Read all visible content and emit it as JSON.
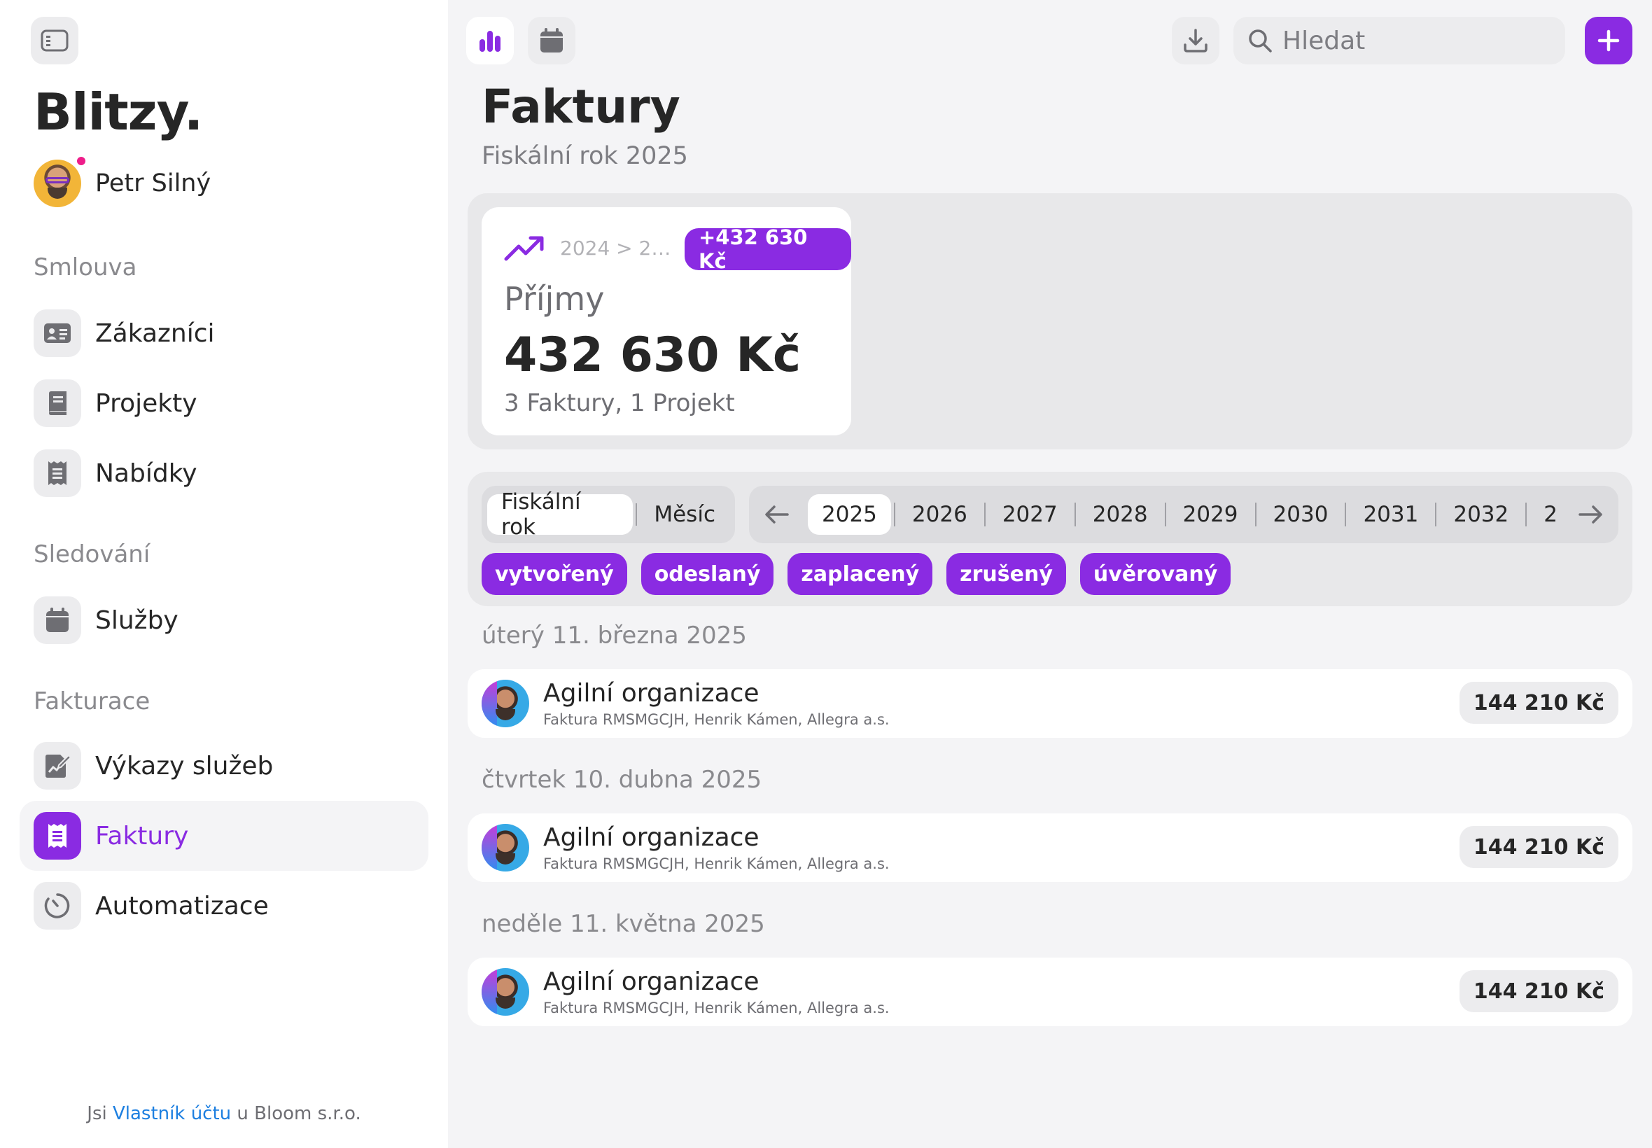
{
  "sidebar": {
    "brand": "Blitzy.",
    "user_name": "Petr Silný",
    "sections": [
      {
        "title": "Smlouva",
        "items": [
          {
            "label": "Zákazníci"
          },
          {
            "label": "Projekty"
          },
          {
            "label": "Nabídky"
          }
        ]
      },
      {
        "title": "Sledování",
        "items": [
          {
            "label": "Služby"
          }
        ]
      },
      {
        "title": "Fakturace",
        "items": [
          {
            "label": "Výkazy služeb"
          },
          {
            "label": "Faktury",
            "active": true
          },
          {
            "label": "Automatizace"
          }
        ]
      }
    ],
    "footer": {
      "prefix": "Jsi",
      "role": "Vlastník účtu",
      "suffix": "u Bloom s.r.o."
    }
  },
  "toolbar": {
    "search_placeholder": "Hledat"
  },
  "page": {
    "title": "Faktury",
    "subtitle": "Fiskální rok 2025"
  },
  "stat": {
    "compare": "2024 > 2…",
    "badge": "+432 630 Kč",
    "label": "Příjmy",
    "value": "432 630 Kč",
    "detail": "3 Faktury, 1 Projekt"
  },
  "filters": {
    "period": [
      "Fiskální rok",
      "Měsíc"
    ],
    "period_selected": 0,
    "years": [
      "2025",
      "2026",
      "2027",
      "2028",
      "2029",
      "2030",
      "2031",
      "2032",
      "2"
    ],
    "year_selected": 0,
    "statuses": [
      "vytvořený",
      "odeslaný",
      "zaplacený",
      "zrušený",
      "úvěrovaný"
    ]
  },
  "groups": [
    {
      "date": "úterý 11. března 2025",
      "items": [
        {
          "title": "Agilní organizace",
          "subtitle": "Faktura RMSMGCJH, Henrik Kámen, Allegra a.s.",
          "amount": "144 210 Kč"
        }
      ]
    },
    {
      "date": "čtvrtek 10. dubna 2025",
      "items": [
        {
          "title": "Agilní organizace",
          "subtitle": "Faktura RMSMGCJH, Henrik Kámen, Allegra a.s.",
          "amount": "144 210 Kč"
        }
      ]
    },
    {
      "date": "neděle 11. května 2025",
      "items": [
        {
          "title": "Agilní organizace",
          "subtitle": "Faktura RMSMGCJH, Henrik Kámen, Allegra a.s.",
          "amount": "144 210 Kč"
        }
      ]
    }
  ],
  "colors": {
    "accent": "#8a2be2",
    "link": "#1d7fe0",
    "notification": "#ee1d8a"
  }
}
